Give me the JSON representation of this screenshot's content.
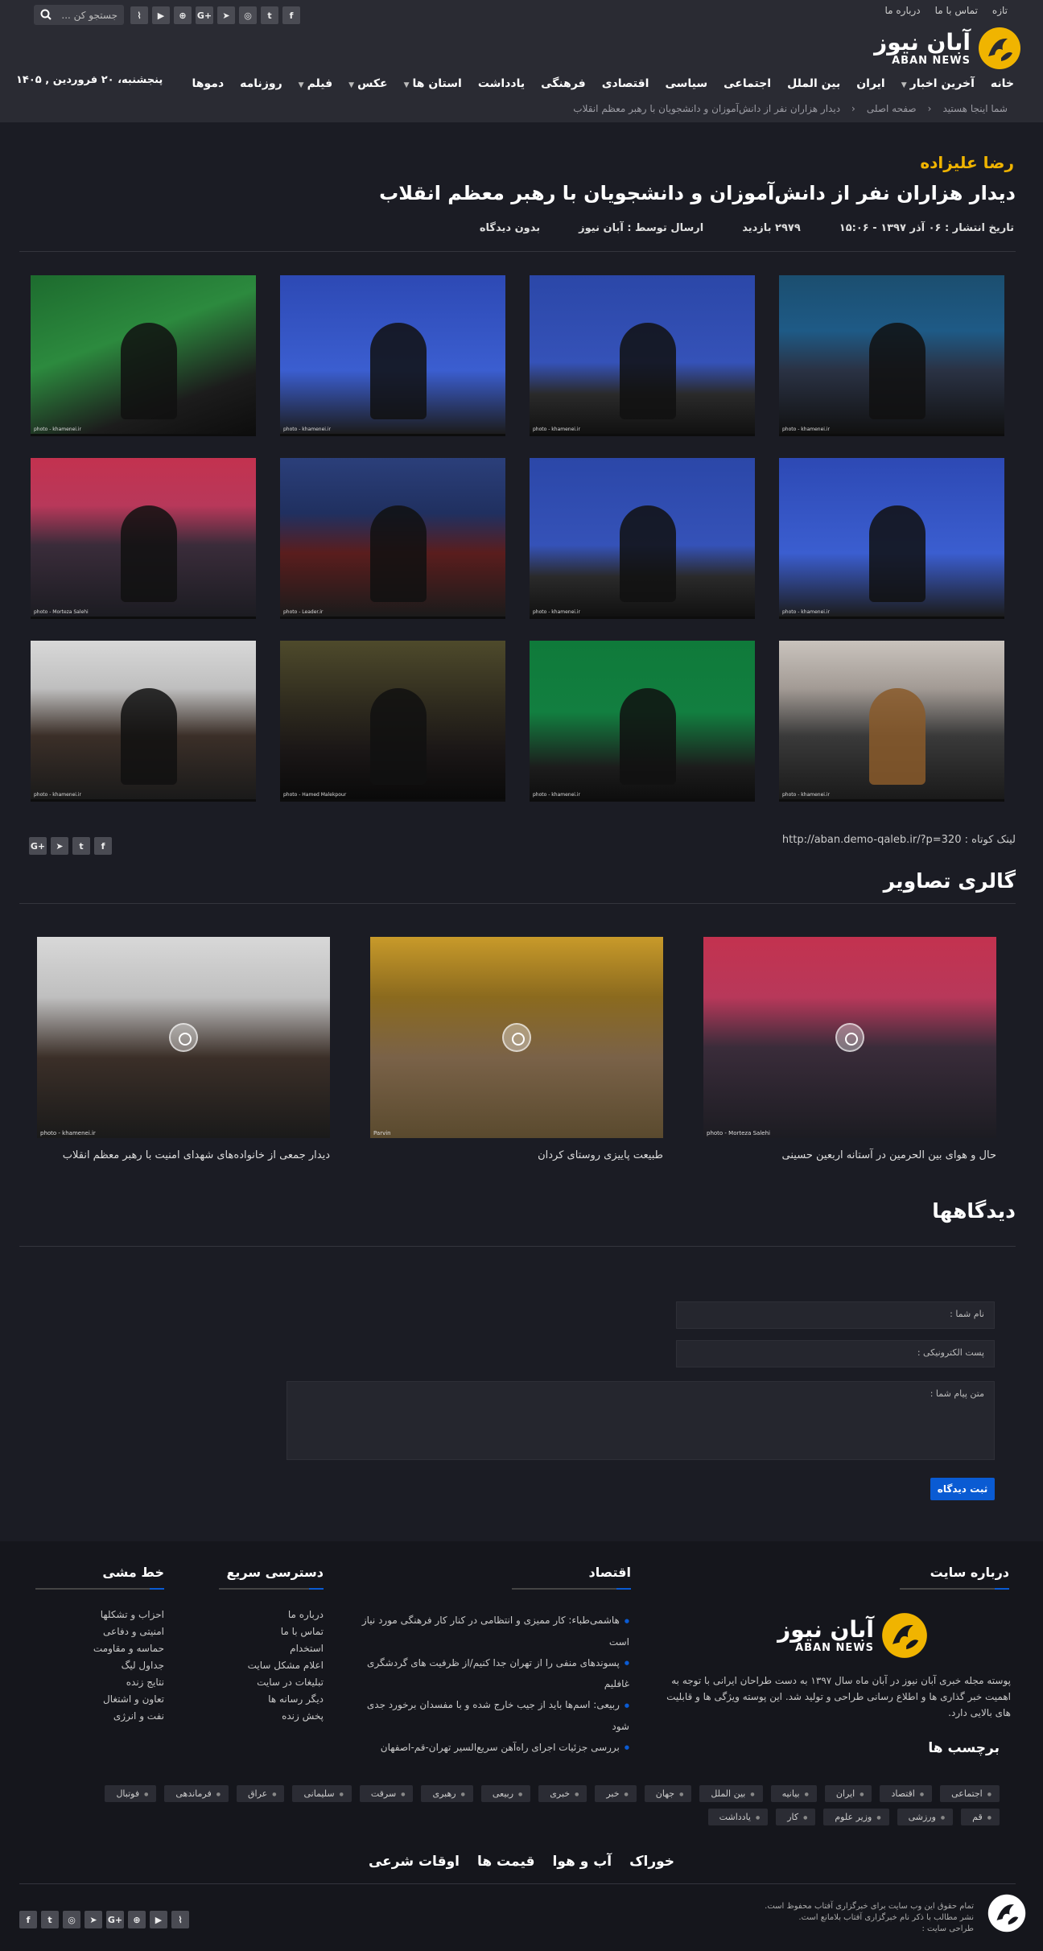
{
  "header": {
    "top_links": [
      "تازه",
      "تماس با ما",
      "درباره ما"
    ],
    "search_placeholder": "جستجو کن ...",
    "social": [
      "f",
      "t",
      "ig",
      "tg",
      "G+",
      "⊕",
      "▶",
      "rss"
    ],
    "logo_fa": "آبان نیوز",
    "logo_en": "ABAN NEWS",
    "date": "پنجشنبه، ۲۰ فروردین , ۱۴۰۵",
    "nav": [
      {
        "label": "خانه",
        "caret": false
      },
      {
        "label": "آخرین اخبار",
        "caret": true
      },
      {
        "label": "ایران",
        "caret": false
      },
      {
        "label": "بین الملل",
        "caret": false
      },
      {
        "label": "اجتماعی",
        "caret": false
      },
      {
        "label": "سیاسی",
        "caret": false
      },
      {
        "label": "اقتصادی",
        "caret": false
      },
      {
        "label": "فرهنگی",
        "caret": false
      },
      {
        "label": "یادداشت",
        "caret": false
      },
      {
        "label": "استان ها",
        "caret": true
      },
      {
        "label": "عکس",
        "caret": true
      },
      {
        "label": "فیلم",
        "caret": true
      },
      {
        "label": "روزنامه",
        "caret": false
      },
      {
        "label": "دموها",
        "caret": false
      }
    ],
    "breadcrumb": [
      "شما اینجا هستید",
      "صفحه اصلی",
      "دیدار هزاران نفر از دانش‌آموزان و دانشجویان با رهبر معظم انقلاب"
    ]
  },
  "article": {
    "author": "رضا علیزاده",
    "title": "دیدار هزاران نفر از دانش‌آموزان و دانشجویان با رهبر معظم انقلاب",
    "meta": [
      "تاریخ انتشار : ۰۶ آذر ۱۳۹۷ - ۱۵:۰۶",
      "۲۹۷۹ بازدید",
      "ارسال توسط : آبان نیوز",
      "بدون دیدگاه"
    ],
    "photos": [
      {
        "credit": "photo - khamenei.ir",
        "scene": "hall"
      },
      {
        "credit": "photo - khamenei.ir",
        "scene": "stage"
      },
      {
        "credit": "photo - khamenei.ir",
        "scene": "blue"
      },
      {
        "credit": "photo - khamenei.ir",
        "scene": "green"
      },
      {
        "credit": "photo - khamenei.ir",
        "scene": "blue"
      },
      {
        "credit": "photo - khamenei.ir",
        "scene": "stage"
      },
      {
        "credit": "photo - Leader.ir",
        "scene": "crowd-red"
      },
      {
        "credit": "photo - Morteza Salehi",
        "scene": "crowd-pink"
      },
      {
        "credit": "photo - khamenei.ir",
        "scene": "tan"
      },
      {
        "credit": "photo - khamenei.ir",
        "scene": "green2"
      },
      {
        "credit": "photo - Hamed Malekpour",
        "scene": "dark"
      },
      {
        "credit": "photo - khamenei.ir",
        "scene": "grey"
      }
    ],
    "shortlink": "لینک کوتاه : http://aban.demo-qaleb.ir/?p=320",
    "share": [
      "G+",
      "tg",
      "t",
      "f"
    ]
  },
  "gallery": {
    "title": "گالری تصاویر",
    "items": [
      {
        "caption": "حال و هوای بین الحرمین در آستانه اربعین حسینی",
        "scene": "crowd-pink",
        "credit": "photo - Morteza Salehi"
      },
      {
        "caption": "طبیعت پاییزی روستای کردان",
        "scene": "autumn",
        "credit": "Parvin"
      },
      {
        "caption": "دیدار جمعی از خانواده‌های شهدای امنیت با رهبر معظم انقلاب",
        "scene": "grey",
        "credit": "photo - khamenei.ir"
      }
    ]
  },
  "comments": {
    "title": "دیدگاهها",
    "name_placeholder": "نام شما :",
    "email_placeholder": "پست الکترونیکی :",
    "message_placeholder": "متن پیام شما :",
    "submit": "ثبت دیدگاه"
  },
  "footer": {
    "about_title": "درباره سایت",
    "about_text": "پوسته مجله خبری آبان نیوز در آبان ماه سال ۱۳۹۷ به دست طراحان ایرانی با توجه به اهمیت خبر گذاری ها و اطلاع رسانی طراحی و تولید شد. این پوسته ویژگی ها و قابلیت های بالایی دارد.",
    "economy_title": "اقتصاد",
    "economy_news": [
      "هاشمی‌طباء: کار ممیزی و انتظامی در کنار کار فرهنگی مورد نیاز است",
      "پسوندهای منفی را از تهران جدا کنیم/از ظرفیت های گردشگری غافلیم",
      "ربیعی: اسم‌ها باید از جیب خارج شده و با مفسدان برخورد جدی شود",
      "بررسی جزئیات اجرای راه‌آهن سریع‌السیر تهران-قم-اصفهان"
    ],
    "quick_title": "دسترسی سریع",
    "quick_links": [
      "درباره ما",
      "تماس با ما",
      "استخدام",
      "اعلام مشکل سایت",
      "تبلیغات در سایت",
      "دیگر رسانه ها",
      "پخش زنده"
    ],
    "policy_title": "خط مشی",
    "policy_links": [
      "احزاب و تشکلها",
      "امنیتی و دفاعی",
      "حماسه و مقاومت",
      "جداول لیگ",
      "نتایج زنده",
      "تعاون و اشتغال",
      "نفت و انرژی"
    ],
    "tags_title": "برچسب ها",
    "tags": [
      "اجتماعی",
      "اقتصاد",
      "ایران",
      "بیانیه",
      "بین الملل",
      "جهان",
      "خبر",
      "خبری",
      "ربیعی",
      "رهبری",
      "سرقت",
      "سلیمانی",
      "عراق",
      "فرماندهی",
      "فوتبال",
      "قم",
      "ورزشی",
      "وزیر علوم",
      "کار",
      "یادداشت"
    ],
    "links": [
      "خوراک",
      "آب و هوا",
      "قیمت ها",
      "اوقات شرعی"
    ],
    "copyright": [
      "تمام حقوق این وب سایت برای خبرگزاری آفتاب محفوظ است.",
      "نشر مطالب با ذکر نام خبرگزاری آفتاب بلامانع است.",
      "طراحی سایت :"
    ],
    "social": [
      "f",
      "t",
      "ig",
      "tg",
      "G+",
      "⊕",
      "▶",
      "rss"
    ]
  },
  "colors": {
    "accent": "#0a5bd3",
    "author": "#f0b400",
    "bg": "#1b1c24",
    "header": "#2a2b33"
  }
}
